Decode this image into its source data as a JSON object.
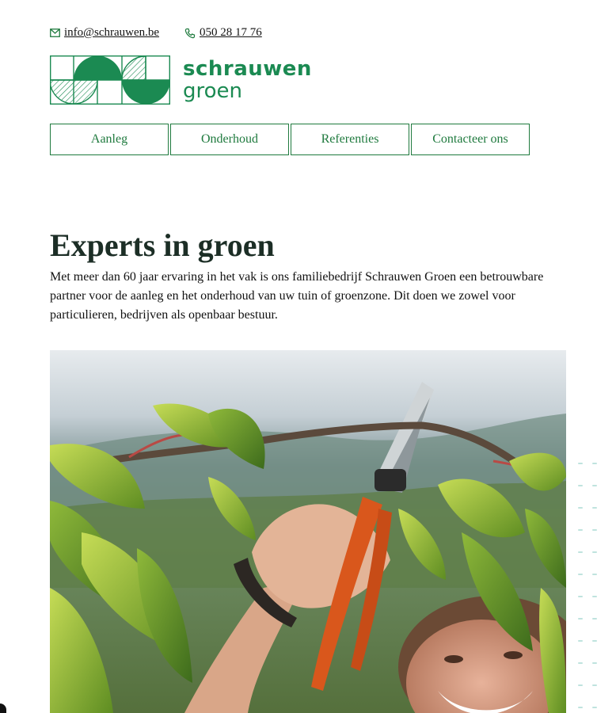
{
  "contact": {
    "email": "info@schrauwen.be",
    "phone": "050 28 17 76"
  },
  "logo": {
    "line1": "schrauwen",
    "line2": "groen"
  },
  "nav": {
    "items": [
      {
        "label": "Aanleg"
      },
      {
        "label": "Onderhoud"
      },
      {
        "label": "Referenties"
      },
      {
        "label": "Contacteer ons"
      }
    ]
  },
  "hero": {
    "title": "Experts in groen",
    "intro": "Met meer dan 60 jaar ervaring in het vak is ons familiebedrijf Schrauwen Groen een betrouwbare partner voor de aanleg en het onderhoud van uw tuin of groenzone. Dit doen we zowel voor particulieren, bedrijven als openbaar bestuur."
  },
  "colors": {
    "brand_green": "#1b8a52",
    "nav_green": "#1f7a3e",
    "heading": "#1c2e26"
  }
}
